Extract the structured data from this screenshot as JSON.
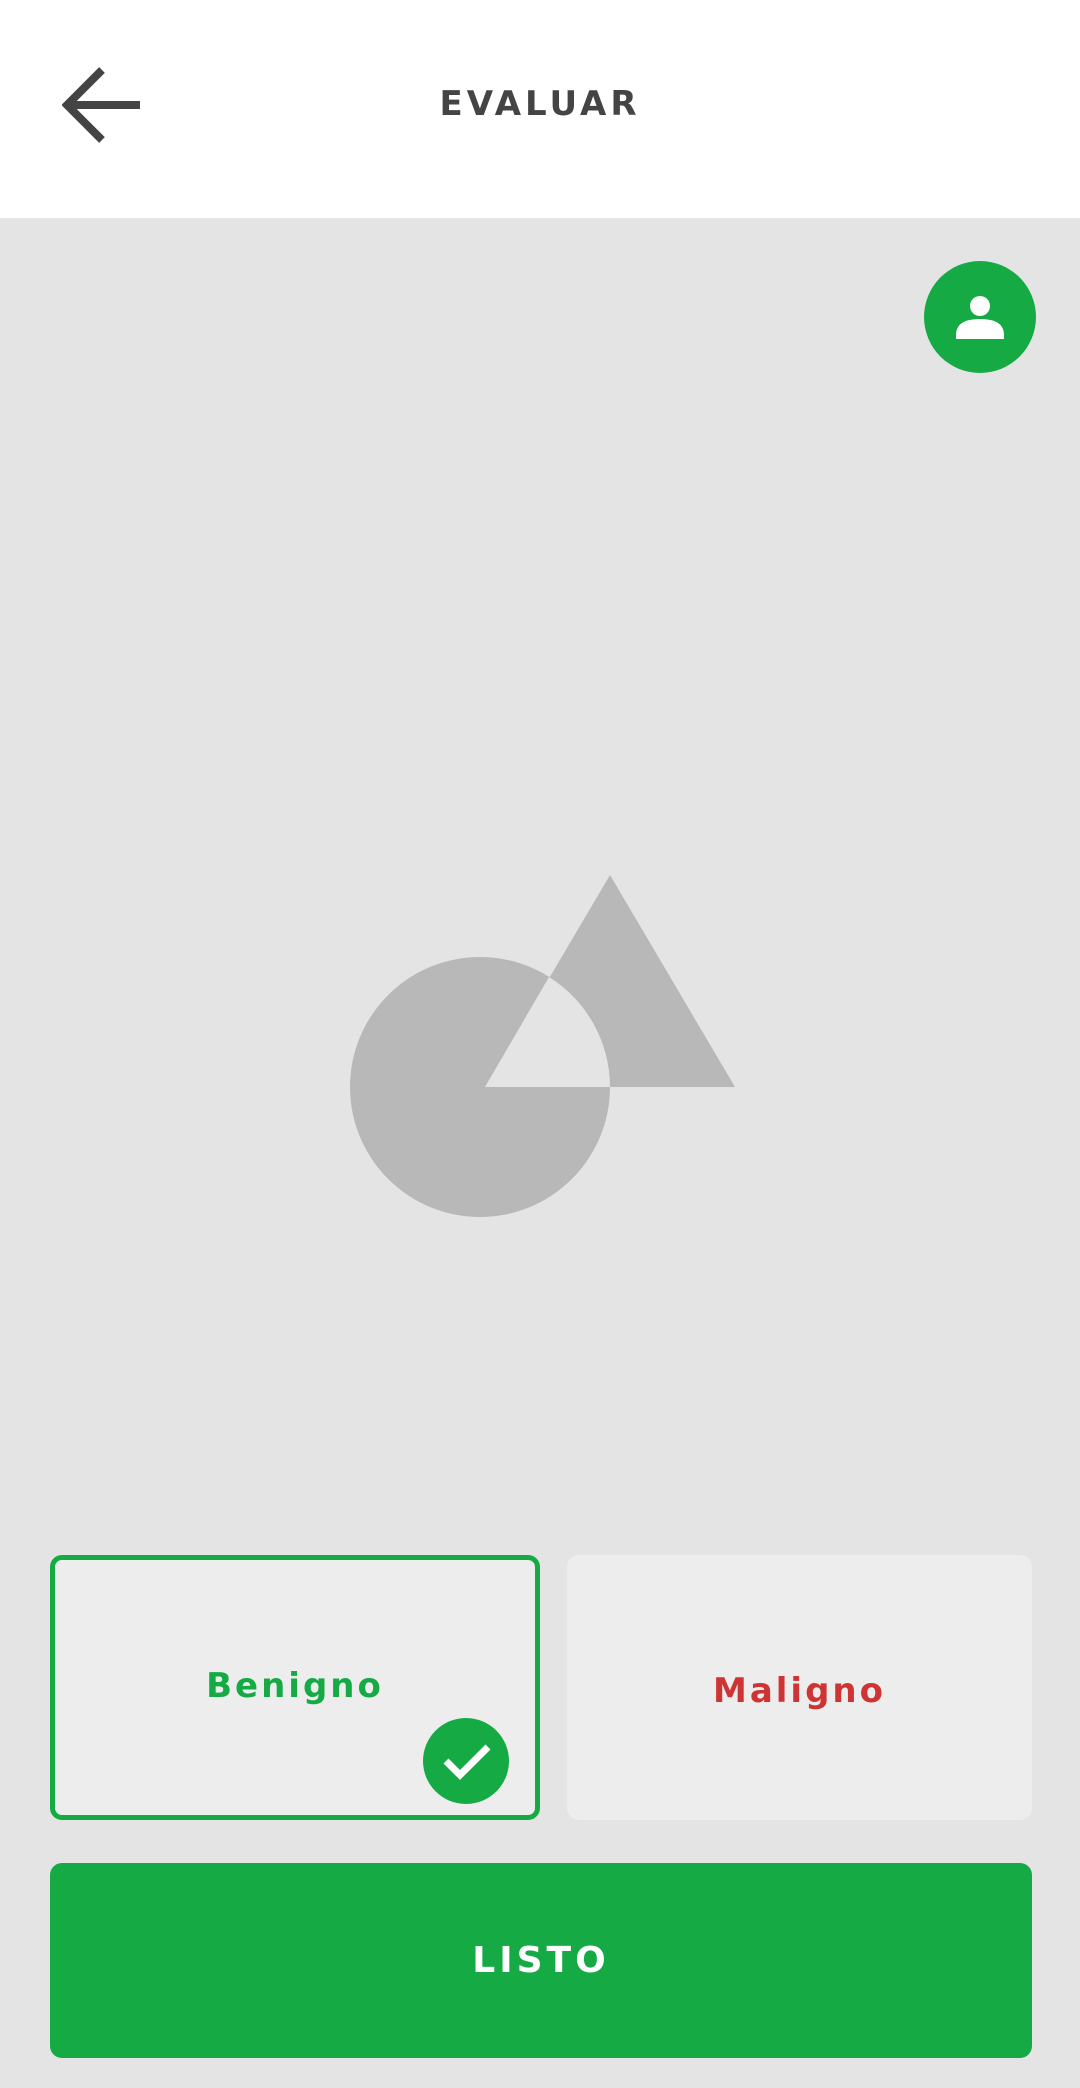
{
  "header": {
    "title": "EVALUAR",
    "back_icon": "arrow-left-icon"
  },
  "avatar": {
    "icon": "person-icon"
  },
  "image": {
    "icon": "image-placeholder-icon"
  },
  "choices": {
    "benign": {
      "label": "Benigno",
      "selected": true,
      "color": "#15aa44",
      "badge_icon": "check-icon"
    },
    "malign": {
      "label": "Maligno",
      "selected": false,
      "color": "#cf3434"
    }
  },
  "actions": {
    "done_label": "LISTO"
  },
  "colors": {
    "accent": "#15aa44",
    "danger": "#cf3434",
    "background": "#e4e4e4",
    "header_bg": "#ffffff",
    "card_bg": "#ededed",
    "title_text": "#444444"
  }
}
